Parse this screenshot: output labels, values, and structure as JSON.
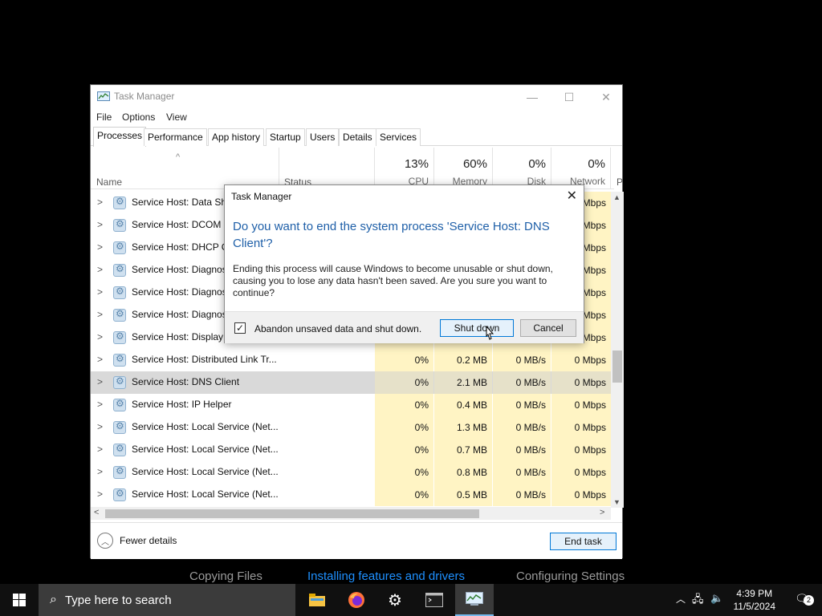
{
  "taskmgr": {
    "title": "Task Manager",
    "menu": [
      "File",
      "Options",
      "View"
    ],
    "tabs": [
      "Processes",
      "Performance",
      "App history",
      "Startup",
      "Users",
      "Details",
      "Services"
    ],
    "columns": {
      "name": "Name",
      "status": "Status",
      "cpu_pct": "13%",
      "cpu": "CPU",
      "mem_pct": "60%",
      "mem": "Memory",
      "disk_pct": "0%",
      "disk": "Disk",
      "net_pct": "0%",
      "net": "Network",
      "power": "P"
    },
    "rows": [
      {
        "name": "Service Host: Data Sha",
        "cpu": "",
        "mem": "",
        "disk": "",
        "net": "Mbps"
      },
      {
        "name": "Service Host: DCOM S",
        "cpu": "",
        "mem": "",
        "disk": "",
        "net": "Mbps"
      },
      {
        "name": "Service Host: DHCP Cl",
        "cpu": "",
        "mem": "",
        "disk": "",
        "net": "Mbps"
      },
      {
        "name": "Service Host: Diagnost",
        "cpu": "",
        "mem": "",
        "disk": "",
        "net": "Mbps"
      },
      {
        "name": "Service Host: Diagnost",
        "cpu": "",
        "mem": "",
        "disk": "",
        "net": "Mbps"
      },
      {
        "name": "Service Host: Diagnost",
        "cpu": "",
        "mem": "",
        "disk": "",
        "net": "Mbps"
      },
      {
        "name": "Service Host: Display P",
        "cpu": "",
        "mem": "",
        "disk": "",
        "net": "Mbps"
      },
      {
        "name": "Service Host: Distributed Link Tr...",
        "cpu": "0%",
        "mem": "0.2 MB",
        "disk": "0 MB/s",
        "net": "0 Mbps"
      },
      {
        "name": "Service Host: DNS Client",
        "cpu": "0%",
        "mem": "2.1 MB",
        "disk": "0 MB/s",
        "net": "0 Mbps",
        "selected": true
      },
      {
        "name": "Service Host: IP Helper",
        "cpu": "0%",
        "mem": "0.4 MB",
        "disk": "0 MB/s",
        "net": "0 Mbps"
      },
      {
        "name": "Service Host: Local Service (Net...",
        "cpu": "0%",
        "mem": "1.3 MB",
        "disk": "0 MB/s",
        "net": "0 Mbps"
      },
      {
        "name": "Service Host: Local Service (Net...",
        "cpu": "0%",
        "mem": "0.7 MB",
        "disk": "0 MB/s",
        "net": "0 Mbps"
      },
      {
        "name": "Service Host: Local Service (Net...",
        "cpu": "0%",
        "mem": "0.8 MB",
        "disk": "0 MB/s",
        "net": "0 Mbps"
      },
      {
        "name": "Service Host: Local Service (Net...",
        "cpu": "0%",
        "mem": "0.5 MB",
        "disk": "0 MB/s",
        "net": "0 Mbps"
      }
    ],
    "fewer_details": "Fewer details",
    "end_task": "End task"
  },
  "dialog": {
    "title": "Task Manager",
    "heading": "Do you want to end the system process 'Service Host: DNS Client'?",
    "body": "Ending this process will cause Windows to become unusable or shut down, causing you to lose any data hasn't been saved. Are you sure you want to continue?",
    "checkbox_label": "Abandon unsaved data and shut down.",
    "checkbox_checked": true,
    "shutdown_label": "Shut down",
    "cancel_label": "Cancel"
  },
  "setup_steps": [
    {
      "label": "Copying Files",
      "color": "#9a9a9a"
    },
    {
      "label": "Installing features and drivers",
      "color": "#1e90ff"
    },
    {
      "label": "Configuring Settings",
      "color": "#9a9a9a"
    }
  ],
  "taskbar": {
    "search_placeholder": "Type here to search",
    "apps": [
      "file-explorer-icon",
      "firefox-icon",
      "settings-icon",
      "terminal-icon",
      "task-manager-icon"
    ],
    "time": "4:39 PM",
    "date": "11/5/2024",
    "notification_count": "2"
  }
}
